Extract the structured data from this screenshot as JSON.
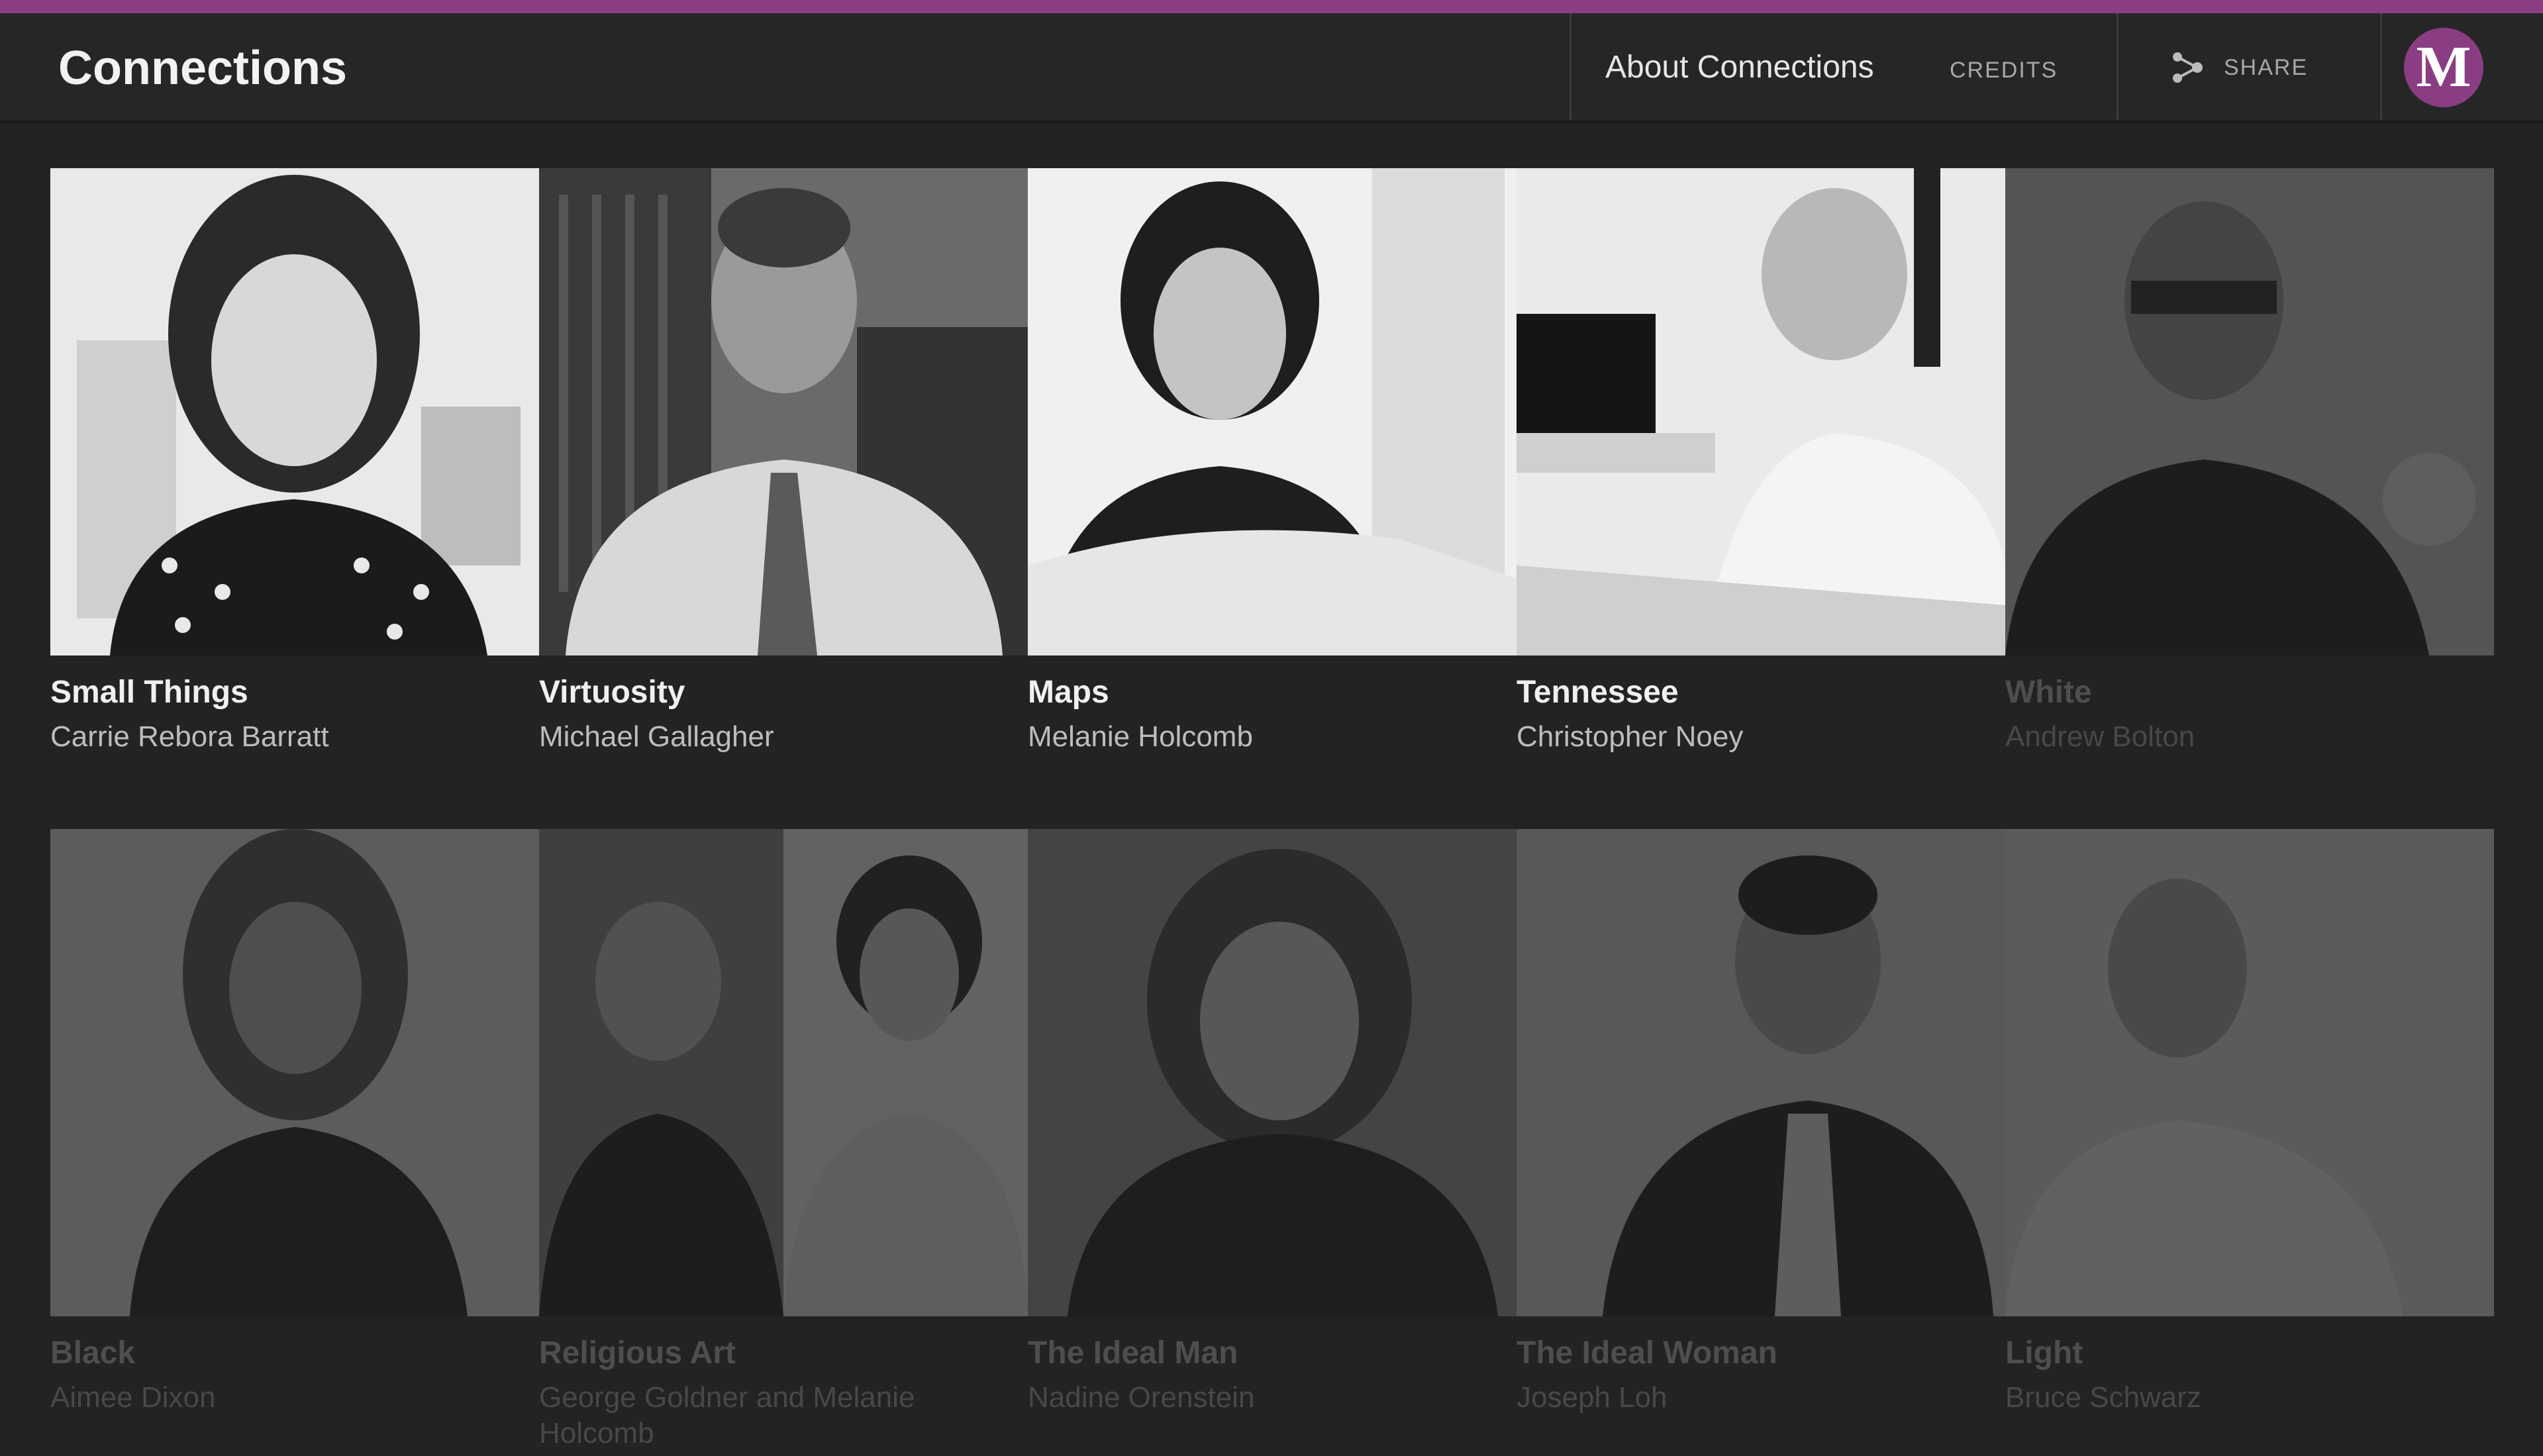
{
  "header": {
    "title": "Connections",
    "nav": {
      "about": "About Connections",
      "credits": "CREDITS",
      "share": "SHARE"
    },
    "logo_letter": "M"
  },
  "colors": {
    "accent": "#8a3d82",
    "background": "#232323"
  },
  "episodes": [
    {
      "title": "Small Things",
      "author": "Carrie Rebora Barratt",
      "active": true
    },
    {
      "title": "Virtuosity",
      "author": "Michael Gallagher",
      "active": true
    },
    {
      "title": "Maps",
      "author": "Melanie Holcomb",
      "active": true
    },
    {
      "title": "Tennessee",
      "author": "Christopher Noey",
      "active": true
    },
    {
      "title": "White",
      "author": "Andrew Bolton",
      "active": false
    },
    {
      "title": "Black",
      "author": "Aimee Dixon",
      "active": false
    },
    {
      "title": "Religious Art",
      "author": "George Goldner and Melanie Holcomb",
      "active": false
    },
    {
      "title": "The Ideal Man",
      "author": "Nadine Orenstein",
      "active": false
    },
    {
      "title": "The Ideal Woman",
      "author": "Joseph Loh",
      "active": false
    },
    {
      "title": "Light",
      "author": "Bruce Schwarz",
      "active": false
    }
  ]
}
